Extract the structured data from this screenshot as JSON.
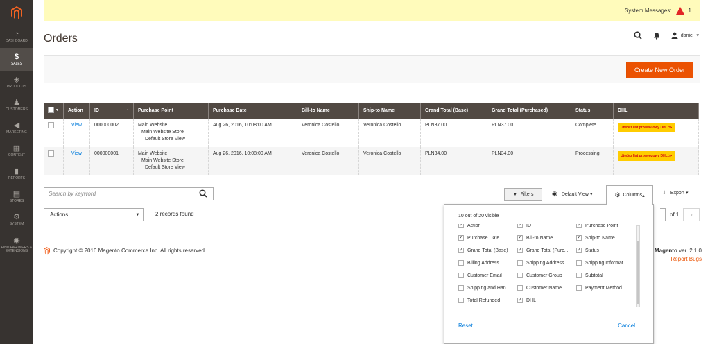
{
  "sidebar": {
    "items": [
      {
        "label": "Dashboard",
        "icon": "dashboard-icon",
        "glyph": "◔"
      },
      {
        "label": "Sales",
        "icon": "dollar-icon",
        "glyph": "$"
      },
      {
        "label": "Products",
        "icon": "cube-icon",
        "glyph": "◈"
      },
      {
        "label": "Customers",
        "icon": "person-icon",
        "glyph": "♟"
      },
      {
        "label": "Marketing",
        "icon": "megaphone-icon",
        "glyph": "◀"
      },
      {
        "label": "Content",
        "icon": "content-icon",
        "glyph": "▦"
      },
      {
        "label": "Reports",
        "icon": "bar-chart-icon",
        "glyph": "▮"
      },
      {
        "label": "Stores",
        "icon": "store-icon",
        "glyph": "▤"
      },
      {
        "label": "System",
        "icon": "gear-icon",
        "glyph": "⚙"
      },
      {
        "label": "Find Partners & Extensions",
        "icon": "partners-icon",
        "glyph": "◉"
      }
    ]
  },
  "system_messages": {
    "label": "System Messages:",
    "count": "1"
  },
  "page": {
    "title": "Orders"
  },
  "header": {
    "user": "daniel"
  },
  "create_order_label": "Create New Order",
  "grid": {
    "headers": [
      "Action",
      "ID",
      "Purchase Point",
      "Purchase Date",
      "Bill-to Name",
      "Ship-to Name",
      "Grand Total (Base)",
      "Grand Total (Purchased)",
      "Status",
      "DHL"
    ],
    "sort_indicator": "↑",
    "rows": [
      {
        "action": "View",
        "id": "000000002",
        "pp1": "Main Website",
        "pp2": "Main Website Store",
        "pp3": "Default Store View",
        "date": "Aug 26, 2016, 10:08:00 AM",
        "bill": "Veronica Costello",
        "ship": "Veronica Costello",
        "base": "PLN37.00",
        "purchased": "PLN37.00",
        "status": "Complete",
        "dhl": "Utwórz list przewozowy DHL ≫"
      },
      {
        "action": "View",
        "id": "000000001",
        "pp1": "Main Website",
        "pp2": "Main Website Store",
        "pp3": "Default Store View",
        "date": "Aug 26, 2016, 10:08:00 AM",
        "bill": "Veronica Costello",
        "ship": "Veronica Costello",
        "base": "PLN34.00",
        "purchased": "PLN34.00",
        "status": "Processing",
        "dhl": "Utwórz list przewozowy DHL ≫"
      }
    ]
  },
  "toolbar": {
    "search_placeholder": "Search by keyword",
    "filters": "Filters",
    "default_view": "Default View",
    "columns": "Columns",
    "export": "Export",
    "actions": "Actions",
    "records": "2 records found",
    "of_pages": "of 1"
  },
  "columns_panel": {
    "visible_count": "10 out of 20 visible",
    "reset": "Reset",
    "cancel": "Cancel",
    "items": [
      {
        "label": "Action",
        "checked": true
      },
      {
        "label": "ID",
        "checked": true
      },
      {
        "label": "Purchase Point",
        "checked": true
      },
      {
        "label": "Purchase Date",
        "checked": true
      },
      {
        "label": "Bill-to Name",
        "checked": true
      },
      {
        "label": "Ship-to Name",
        "checked": true
      },
      {
        "label": "Grand Total (Base)",
        "checked": true
      },
      {
        "label": "Grand Total (Purc...",
        "checked": true
      },
      {
        "label": "Status",
        "checked": true
      },
      {
        "label": "Billing Address",
        "checked": false
      },
      {
        "label": "Shipping Address",
        "checked": false
      },
      {
        "label": "Shipping Informat...",
        "checked": false
      },
      {
        "label": "Customer Email",
        "checked": false
      },
      {
        "label": "Customer Group",
        "checked": false
      },
      {
        "label": "Subtotal",
        "checked": false
      },
      {
        "label": "Shipping and Han...",
        "checked": false
      },
      {
        "label": "Customer Name",
        "checked": false
      },
      {
        "label": "Payment Method",
        "checked": false
      },
      {
        "label": "Total Refunded",
        "checked": false
      },
      {
        "label": "DHL",
        "checked": true
      }
    ]
  },
  "footer": {
    "copyright": "Copyright © 2016 Magento Commerce Inc. All rights reserved.",
    "brand": "Magento",
    "version": "ver. 2.1.0",
    "report_bugs": "Report Bugs"
  },
  "colors": {
    "accent": "#eb5202",
    "sidebar": "#373330",
    "grid_header": "#514943",
    "link": "#007bdb"
  }
}
